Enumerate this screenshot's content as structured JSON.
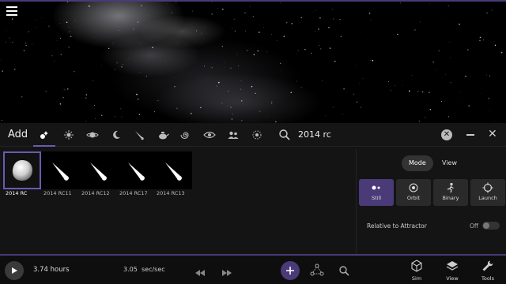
{
  "top_bar": {
    "menu_icon": "hamburger-menu-icon"
  },
  "add_panel": {
    "title": "Add",
    "categories": [
      {
        "name": "all",
        "icon": "sparkle-star-icon",
        "active": true
      },
      {
        "name": "star",
        "icon": "star-burst-icon"
      },
      {
        "name": "planet",
        "icon": "ringed-planet-icon"
      },
      {
        "name": "moon",
        "icon": "crescent-moon-icon"
      },
      {
        "name": "comet",
        "icon": "comet-icon"
      },
      {
        "name": "spacecraft",
        "icon": "teapot-icon"
      },
      {
        "name": "galaxy",
        "icon": "spiral-galaxy-icon"
      },
      {
        "name": "black-hole",
        "icon": "eye-icon"
      },
      {
        "name": "people",
        "icon": "people-icon"
      },
      {
        "name": "other",
        "icon": "target-circle-icon"
      }
    ],
    "search": {
      "icon": "search-icon",
      "value": "2014 rc"
    },
    "results": [
      {
        "label": "2014 RC",
        "type": "asteroid",
        "selected": true
      },
      {
        "label": "2014 RC11",
        "type": "comet"
      },
      {
        "label": "2014 RC12",
        "type": "comet"
      },
      {
        "label": "2014 RC17",
        "type": "comet"
      },
      {
        "label": "2014 RC13",
        "type": "comet"
      }
    ]
  },
  "mode_panel": {
    "tabs": [
      {
        "label": "Mode",
        "active": true
      },
      {
        "label": "View"
      }
    ],
    "modes": [
      {
        "label": "Still",
        "icon": "still-icon",
        "active": true
      },
      {
        "label": "Orbit",
        "icon": "orbit-icon"
      },
      {
        "label": "Binary",
        "icon": "binary-figure-icon"
      },
      {
        "label": "Launch",
        "icon": "crosshair-icon"
      }
    ],
    "relative_label": "Relative to Attractor",
    "relative_state": "Off"
  },
  "bottom_bar": {
    "time": "3.74 hours",
    "rate": "3.05",
    "rate_unit": "sec/sec",
    "nav": [
      {
        "label": "Sim",
        "icon": "cube-icon"
      },
      {
        "label": "View",
        "icon": "layers-icon"
      },
      {
        "label": "Tools",
        "icon": "wrench-icon"
      }
    ]
  },
  "colors": {
    "accent": "#4a3a78",
    "panel": "#141414",
    "background": "#000000"
  }
}
